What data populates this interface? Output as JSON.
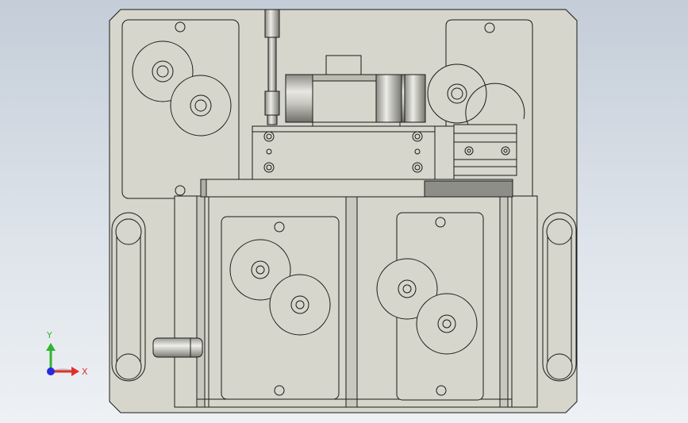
{
  "viewport": {
    "background_top": "#c4cdd8",
    "background_bottom": "#eef1f4",
    "part_fill": "#d7d6cc",
    "part_fill_dark": "#bcbbb0",
    "edge_color": "#1a1a1a"
  },
  "triad": {
    "x_label": "X",
    "y_label": "Y",
    "x_color": "#e0302a",
    "y_color": "#2fb52f",
    "z_color": "#2a2ae0"
  }
}
